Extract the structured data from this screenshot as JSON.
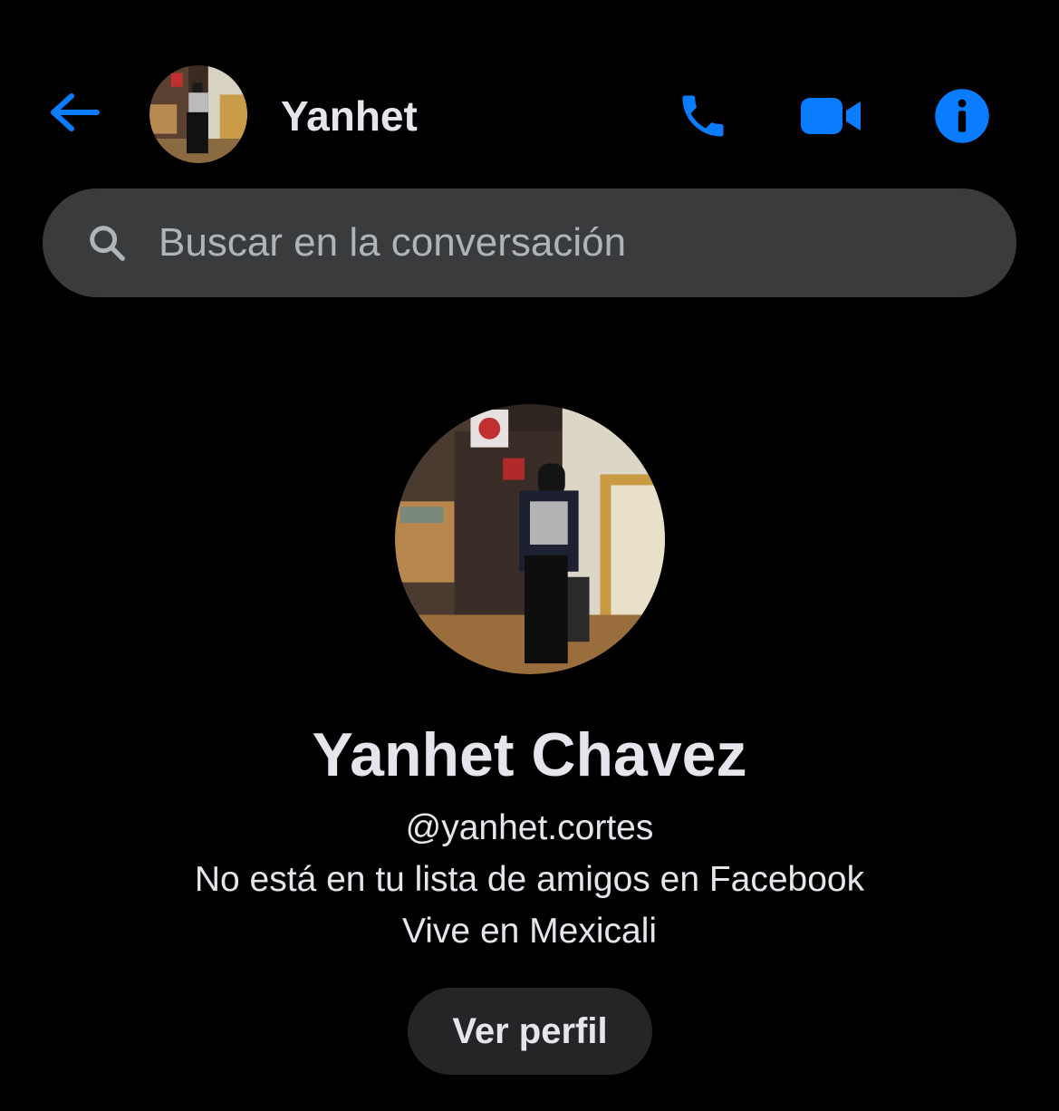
{
  "header": {
    "contact_name": "Yanhet",
    "back_icon": "arrow-left-icon",
    "call_icon": "phone-icon",
    "video_icon": "video-camera-icon",
    "info_icon": "info-icon"
  },
  "search": {
    "placeholder": "Buscar en la conversación",
    "icon": "search-icon"
  },
  "profile": {
    "full_name": "Yanhet Chavez",
    "username": "@yanhet.cortes",
    "friend_status": "No está en tu lista de amigos en Facebook",
    "location": "Vive en Mexicali",
    "view_profile_label": "Ver perfil"
  },
  "colors": {
    "accent": "#0a7cff",
    "background": "#000000",
    "search_bg": "#3a3b3c",
    "button_bg": "#242526",
    "text_primary": "#e4e6eb",
    "text_secondary": "#b0b3b8"
  }
}
